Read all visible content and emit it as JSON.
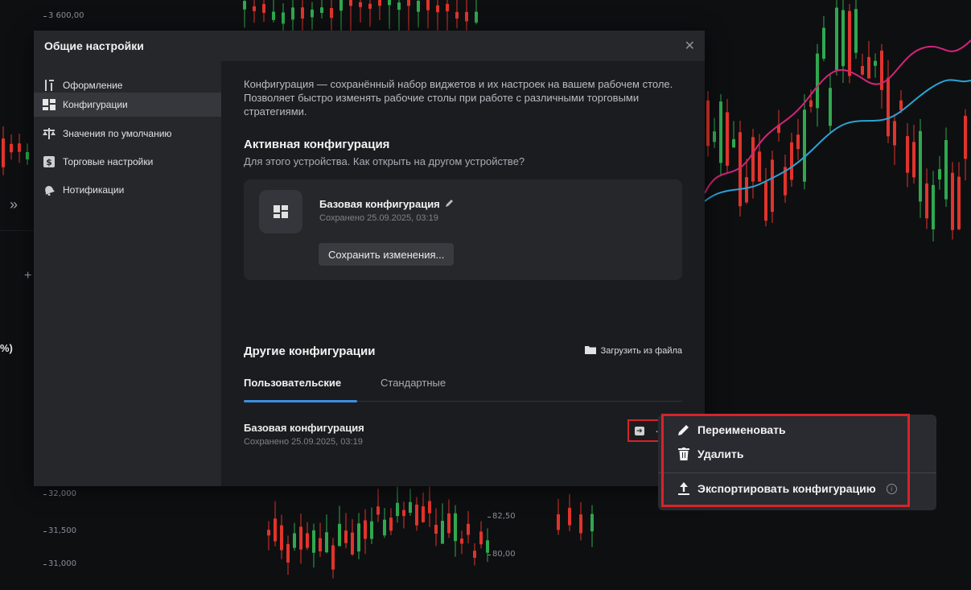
{
  "background": {
    "prices_left": [
      "3 600,00",
      "32,000",
      "31,500",
      "31,000"
    ],
    "prices_mid": [
      "82,50",
      "80,00"
    ],
    "left_control": "%)",
    "expand_icon": "double-chevron-right",
    "plus_icon": "plus"
  },
  "modal": {
    "title": "Общие настройки",
    "close_icon": "close"
  },
  "sidebar": {
    "items": [
      {
        "label": "Оформление",
        "icon": "sort-icon"
      },
      {
        "label": "Конфигурации",
        "icon": "layout-icon"
      },
      {
        "label": "Значения по умолчанию",
        "icon": "scales-icon"
      },
      {
        "label": "Торговые настройки",
        "icon": "dollar-icon"
      },
      {
        "label": "Нотификации",
        "icon": "bell-icon"
      }
    ]
  },
  "content": {
    "description": "Конфигурация — сохранённый набор виджетов и их настроек на вашем рабочем столе. Позволяет быстро изменять рабочие столы при работе с различными торговыми стратегиями.",
    "active_heading": "Активная конфигурация",
    "active_subtitle": "Для этого устройства. Как открыть на другом устройстве?",
    "active_card": {
      "name": "Базовая конфигурация",
      "saved": "Сохранено 25.09.2025, 03:19",
      "save_button": "Сохранить изменения..."
    },
    "other_heading": "Другие конфигурации",
    "load_from_file": "Загрузить из файла",
    "tabs": [
      "Пользовательские",
      "Стандартные"
    ],
    "rows": [
      {
        "name": "Базовая конфигурация",
        "saved": "Сохранено 25.09.2025, 03:19"
      }
    ]
  },
  "menu": {
    "items": [
      {
        "label": "Переименовать",
        "icon": "pencil-icon"
      },
      {
        "label": "Удалить",
        "icon": "trash-icon"
      },
      {
        "label": "Экспортировать конфигурацию",
        "icon": "upload-icon"
      }
    ]
  },
  "colors": {
    "accent": "#3d8fe0",
    "highlight": "#d6232a",
    "candle_up": "#2fa84f",
    "candle_down": "#e0342c"
  }
}
